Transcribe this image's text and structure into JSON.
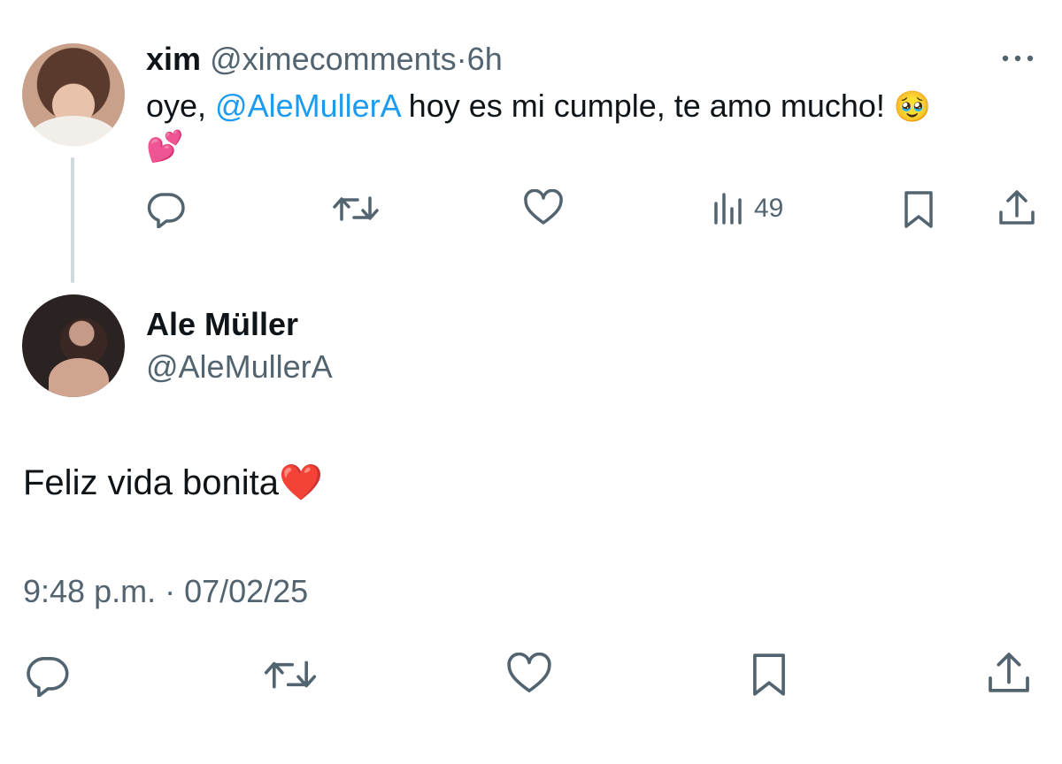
{
  "tweet1": {
    "display_name": "xim",
    "handle": "@ximecomments",
    "separator": "·",
    "time": "6h",
    "text_before": "oye, ",
    "mention": "@AleMullerA",
    "text_after": " hoy es mi cumple, te amo mucho! ",
    "emoji_1": "🥹",
    "emoji_2": "💕",
    "views": "49",
    "actions": {
      "reply": "reply-icon",
      "retweet": "retweet-icon",
      "like": "heart-icon",
      "views": "views-icon",
      "bookmark": "bookmark-icon",
      "share": "share-icon"
    }
  },
  "tweet2": {
    "display_name": "Ale Müller",
    "handle": "@AleMullerA",
    "text": "Feliz vida bonita",
    "emoji": "❤️",
    "timestamp": "9:48 p.m. · 07/02/25",
    "actions": {
      "reply": "reply-icon",
      "retweet": "retweet-icon",
      "like": "heart-icon",
      "bookmark": "bookmark-icon",
      "share": "share-icon"
    }
  },
  "colors": {
    "text": "#0f1419",
    "muted": "#536471",
    "link": "#1d9bf0",
    "thread_line": "#cfd9de"
  }
}
